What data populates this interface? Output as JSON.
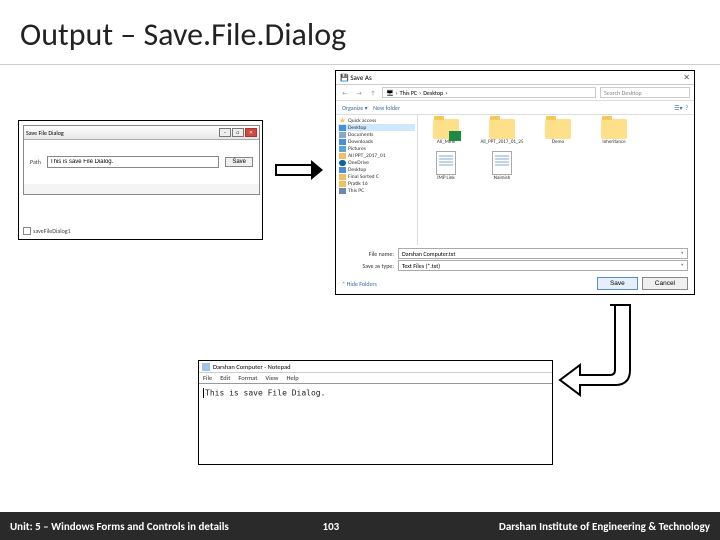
{
  "title": "Output – Save.File.Dialog",
  "panel1": {
    "window_title": "Save File Dialog",
    "path_label": "Path",
    "path_value": "This is save File Dialog.",
    "save_btn": "Save",
    "component": "saveFileDialog1"
  },
  "panel2": {
    "title": "Save As",
    "addr_pc": "This PC",
    "addr_loc": "Desktop",
    "search_placeholder": "Search Desktop",
    "organize": "Organize ▾",
    "new_folder": "New folder",
    "sidebar": {
      "quick": "Quick access",
      "desktop": "Desktop",
      "documents": "Documents",
      "downloads": "Downloads",
      "pictures": "Pictures",
      "ppt": "All PPT_2017_01",
      "onedrive": "OneDrive",
      "desktop2": "Desktop",
      "final": "Final Sorted C",
      "pratik": "Pratik 16",
      "thispc": "This PC"
    },
    "files": {
      "f1": "All_Mine",
      "f2": "All_PPT_2017_01_25",
      "f3": "Demo",
      "f4": "Inheritance",
      "f5": "IMP Link",
      "f6": "Naimish"
    },
    "filename_label": "File name:",
    "filename_value": "Darshan Computer.txt",
    "saveas_label": "Save as type:",
    "saveas_value": "Text Files (*.txt)",
    "hide_folders": "Hide Folders",
    "save": "Save",
    "cancel": "Cancel"
  },
  "panel3": {
    "title": "Darshan Computer - Notepad",
    "menu": {
      "file": "File",
      "edit": "Edit",
      "format": "Format",
      "view": "View",
      "help": "Help"
    },
    "content": "This is save File Dialog."
  },
  "footer": {
    "left": "Unit: 5 – Windows Forms and Controls in details",
    "page": "103",
    "right": "Darshan Institute of Engineering & Technology"
  }
}
